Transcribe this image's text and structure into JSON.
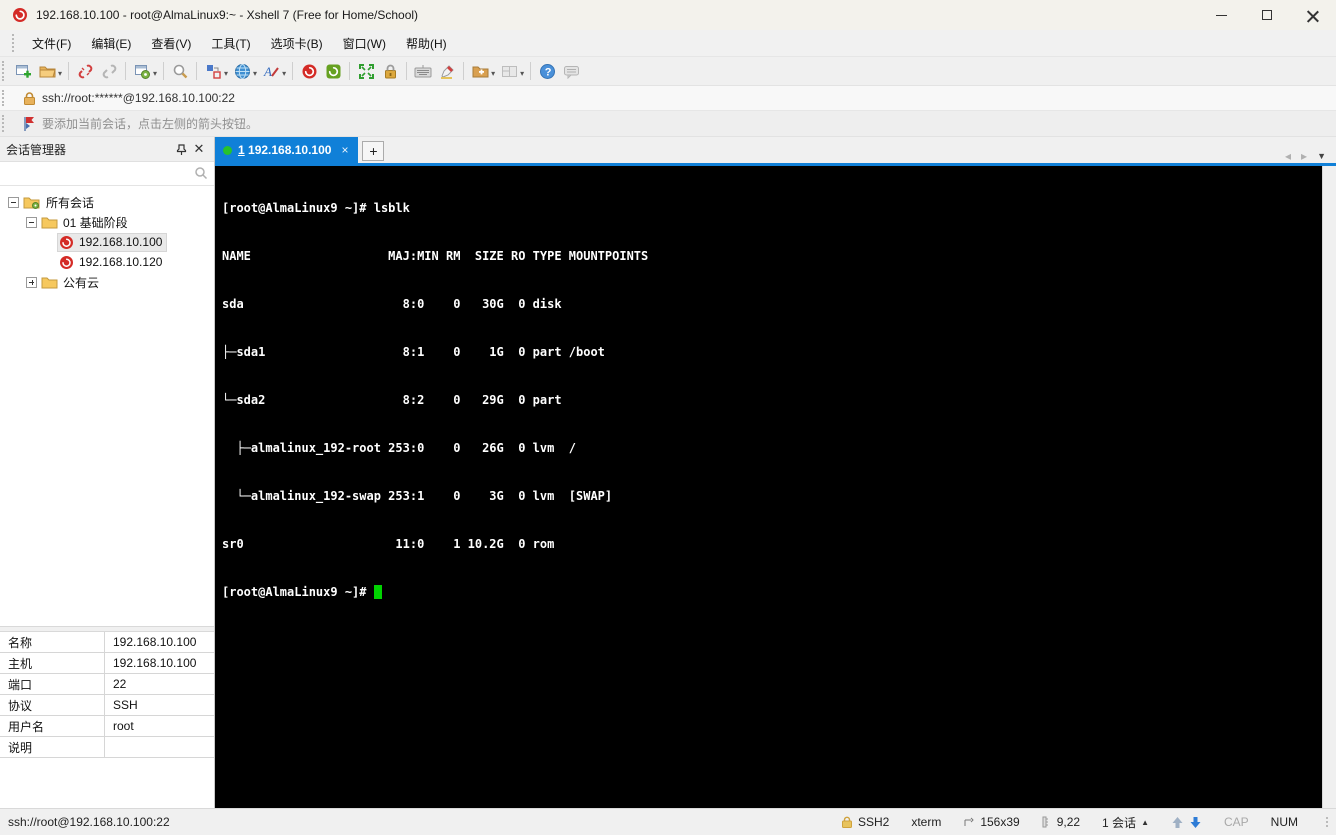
{
  "window": {
    "title": "192.168.10.100 - root@AlmaLinux9:~ - Xshell 7 (Free for Home/School)"
  },
  "menu": {
    "items": [
      "文件(F)",
      "编辑(E)",
      "查看(V)",
      "工具(T)",
      "选项卡(B)",
      "窗口(W)",
      "帮助(H)"
    ]
  },
  "toolbar": {
    "icons": [
      "new-session",
      "open-folder",
      "disconnect",
      "reconnect",
      "session-properties",
      "find",
      "new-file-transfer",
      "web-browser",
      "font",
      "xshell",
      "xftp",
      "fullscreen",
      "lock-screen",
      "virtual-keyboard",
      "highlight",
      "new-terminal",
      "layout",
      "help",
      "feedback"
    ]
  },
  "address_bar": {
    "url": "ssh://root:******@192.168.10.100:22"
  },
  "info_bar": {
    "message": "要添加当前会话，点击左侧的箭头按钮。"
  },
  "session_manager": {
    "title": "会话管理器",
    "search_value": "",
    "tree": [
      {
        "label": "所有会话"
      },
      {
        "label": "01 基础阶段"
      },
      {
        "label": "192.168.10.100"
      },
      {
        "label": "192.168.10.120"
      },
      {
        "label": "公有云"
      }
    ]
  },
  "properties": {
    "rows": [
      {
        "label": "名称",
        "value": "192.168.10.100"
      },
      {
        "label": "主机",
        "value": "192.168.10.100"
      },
      {
        "label": "端口",
        "value": "22"
      },
      {
        "label": "协议",
        "value": "SSH"
      },
      {
        "label": "用户名",
        "value": "root"
      },
      {
        "label": "说明",
        "value": ""
      }
    ]
  },
  "tabs": {
    "active": {
      "number": "1",
      "title": "192.168.10.100",
      "close": "×"
    },
    "new_tab_label": "+"
  },
  "terminal": {
    "lines": [
      "[root@AlmaLinux9 ~]# lsblk",
      "NAME                   MAJ:MIN RM  SIZE RO TYPE MOUNTPOINTS",
      "sda                      8:0    0   30G  0 disk ",
      "├─sda1                   8:1    0    1G  0 part /boot",
      "└─sda2                   8:2    0   29G  0 part ",
      "  ├─almalinux_192-root 253:0    0   26G  0 lvm  /",
      "  └─almalinux_192-swap 253:1    0    3G  0 lvm  [SWAP]",
      "sr0                     11:0    1 10.2G  0 rom  "
    ],
    "prompt": "[root@AlmaLinux9 ~]# "
  },
  "status_bar": {
    "left_url": "ssh://root@192.168.10.100:22",
    "encryption": "SSH2",
    "terminal_type": "xterm",
    "size": "156x39",
    "position": "9,22",
    "session_count": "1 会话",
    "caps": "CAP",
    "num": "NUM"
  },
  "colors": {
    "tab_active": "#1080d8",
    "cursor_green": "#00d300",
    "logo_red": "#d42b26"
  }
}
